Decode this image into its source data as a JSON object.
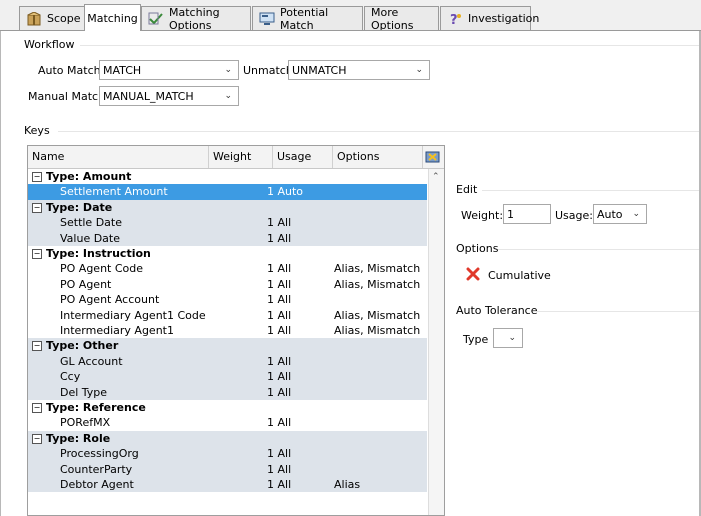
{
  "tabs": [
    {
      "label": "Scope",
      "icon": "package-icon",
      "active": false
    },
    {
      "label": "Matching",
      "icon": "",
      "active": true
    },
    {
      "label": "Matching Options",
      "icon": "checkmark-icon",
      "active": false
    },
    {
      "label": "Potential Match",
      "icon": "screen-icon",
      "active": false
    },
    {
      "label": "More Options",
      "icon": "",
      "active": false
    },
    {
      "label": "Investigation",
      "icon": "question-icon",
      "active": false
    }
  ],
  "workflow": {
    "title": "Workflow",
    "auto_match_label": "Auto Match",
    "auto_match_value": "MATCH",
    "unmatch_label": "Unmatch",
    "unmatch_value": "UNMATCH",
    "manual_match_label": "Manual Match",
    "manual_match_value": "MANUAL_MATCH"
  },
  "keys": {
    "title": "Keys",
    "columns": [
      "Name",
      "Weight",
      "Usage",
      "Options"
    ],
    "rows": [
      {
        "kind": "group",
        "name": "Type: Amount"
      },
      {
        "kind": "item",
        "name": "Settlement Amount",
        "usage": "1 Auto",
        "options": "",
        "selected": true
      },
      {
        "kind": "group",
        "name": "Type: Date"
      },
      {
        "kind": "item",
        "name": "Settle Date",
        "usage": "1 All",
        "options": ""
      },
      {
        "kind": "item",
        "name": "Value Date",
        "usage": "1 All",
        "options": ""
      },
      {
        "kind": "group",
        "name": "Type: Instruction"
      },
      {
        "kind": "item",
        "name": "PO Agent Code",
        "usage": "1 All",
        "options": "Alias, Mismatch"
      },
      {
        "kind": "item",
        "name": "PO Agent",
        "usage": "1 All",
        "options": "Alias, Mismatch"
      },
      {
        "kind": "item",
        "name": "PO Agent Account",
        "usage": "1 All",
        "options": ""
      },
      {
        "kind": "item",
        "name": "Intermediary Agent1 Code",
        "usage": "1 All",
        "options": "Alias, Mismatch"
      },
      {
        "kind": "item",
        "name": "Intermediary Agent1",
        "usage": "1 All",
        "options": "Alias, Mismatch"
      },
      {
        "kind": "group",
        "name": "Type: Other"
      },
      {
        "kind": "item",
        "name": "GL Account",
        "usage": "1 All",
        "options": ""
      },
      {
        "kind": "item",
        "name": "Ccy",
        "usage": "1 All",
        "options": ""
      },
      {
        "kind": "item",
        "name": "Del Type",
        "usage": "1 All",
        "options": ""
      },
      {
        "kind": "group",
        "name": "Type: Reference"
      },
      {
        "kind": "item",
        "name": "PORefMX",
        "usage": "1 All",
        "options": ""
      },
      {
        "kind": "group",
        "name": "Type: Role"
      },
      {
        "kind": "item",
        "name": "ProcessingOrg",
        "usage": "1 All",
        "options": ""
      },
      {
        "kind": "item",
        "name": "CounterParty",
        "usage": "1 All",
        "options": ""
      },
      {
        "kind": "item",
        "name": "Debtor Agent",
        "usage": "1 All",
        "options": "Alias"
      }
    ]
  },
  "edit": {
    "title": "Edit",
    "weight_label": "Weight:",
    "weight_value": "1",
    "usage_label": "Usage:",
    "usage_value": "Auto"
  },
  "options": {
    "title": "Options",
    "cumulative_label": "Cumulative"
  },
  "auto_tolerance": {
    "title": "Auto Tolerance",
    "type_label": "Type",
    "type_value": ""
  },
  "colors": {
    "selected_row": "#3d9be3",
    "group_row": "#dde3ea",
    "cumulative_icon": "#e0392b"
  }
}
